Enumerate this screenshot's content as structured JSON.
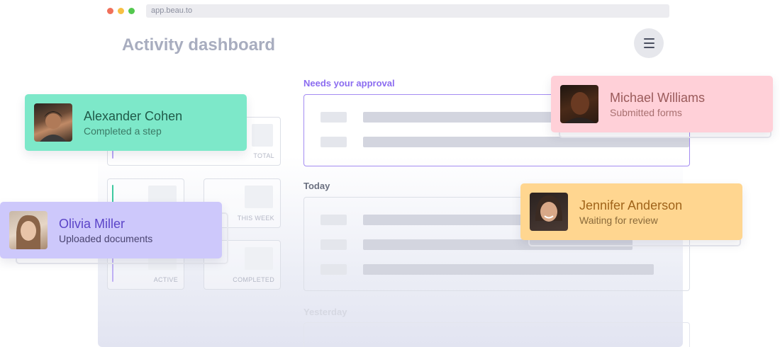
{
  "browser": {
    "url": "app.beau.to"
  },
  "header": {
    "title": "Activity dashboard"
  },
  "stats": [
    {
      "label": "TOTAL"
    },
    {
      "label": "THIS WEEK"
    },
    {
      "label": "ACTIVE"
    },
    {
      "label": "COMPLETED"
    }
  ],
  "sections": {
    "approval": "Needs your approval",
    "today": "Today",
    "yesterday": "Yesterday"
  },
  "activity_cards": [
    {
      "name": "Alexander Cohen",
      "status": "Completed a step",
      "color": "#7de8c9"
    },
    {
      "name": "Michael Williams",
      "status": "Submitted forms",
      "color": "#ffd0d8"
    },
    {
      "name": "Olivia Miller",
      "status": "Uploaded documents",
      "color": "#cdc8fb"
    },
    {
      "name": "Jennifer Anderson",
      "status": "Waiting for review",
      "color": "#ffd690"
    }
  ],
  "colors": {
    "accent": "#8b6cf0",
    "teal": "#3ec9a0",
    "dot_red": "#f0705a",
    "dot_yellow": "#f7c043",
    "dot_green": "#53c84e"
  }
}
